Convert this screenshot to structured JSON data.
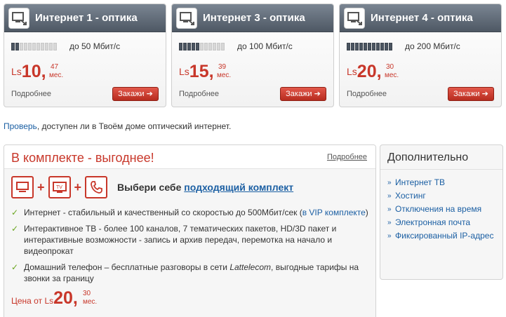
{
  "plans": [
    {
      "title": "Интернет 1 - оптика",
      "speed": "до 50 Мбит/с",
      "level": 0.18,
      "currency": "Ls",
      "price_int": "10,",
      "price_cents": "47",
      "per": "мес.",
      "more": "Подробнее",
      "order": "Закажи ➔"
    },
    {
      "title": "Интернет 3 - оптика",
      "speed": "до 100 Мбит/с",
      "level": 0.45,
      "currency": "Ls",
      "price_int": "15,",
      "price_cents": "39",
      "per": "мес.",
      "more": "Подробнее",
      "order": "Закажи ➔"
    },
    {
      "title": "Интернет 4 - оптика",
      "speed": "до 200 Мбит/с",
      "level": 1.0,
      "currency": "Ls",
      "price_int": "20,",
      "price_cents": "30",
      "per": "мес.",
      "more": "Подробнее",
      "order": "Закажи ➔"
    }
  ],
  "check": {
    "link": "Проверь",
    "text": ", доступен ли в Твоём доме оптический интернет."
  },
  "bundle": {
    "title": "В комплекте - выгоднее!",
    "more": "Подробнее",
    "plus": "+",
    "tv_label": "TV",
    "choose_text": "Выбери себе ",
    "choose_link": "подходящий комплект",
    "features": {
      "f1_text": "Интернет - стабильный и качественный со скоростью до 500Мбит/сек (",
      "f1_link": "в VIP комплекте",
      "f1_end": ")",
      "f2": "Интерактивное ТВ - более 100 каналов, 7 тематических пакетов, HD/3D пакет и интерактивные возможности - запись и архив передач, перемотка на начало и видеопрокат",
      "f3_text": "Домашний телефон – бесплатные разговоры в сети ",
      "f3_brand": "Lattelecom",
      "f3_end": ", выгодные тарифы на звонки за границу"
    },
    "price": {
      "from": "Цена от ",
      "currency": "Ls",
      "int": "20,",
      "cents": "30",
      "per": "мес."
    }
  },
  "extra": {
    "title": "Дополнительно",
    "items": [
      "Интернет ТВ",
      "Хостинг",
      "Отключения на время",
      "Электронная почта",
      "Фиксированный IP-адрес"
    ]
  },
  "colors": {
    "accent": "#c8372a",
    "link": "#1b5fa3",
    "check": "#6aa61f",
    "header": "#5a6470"
  }
}
